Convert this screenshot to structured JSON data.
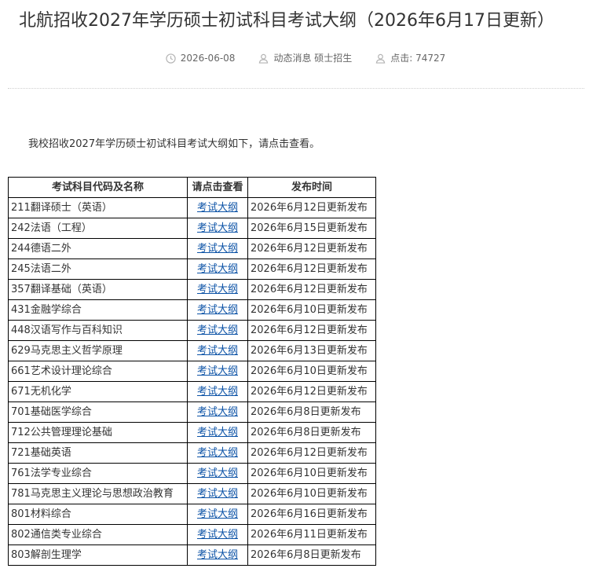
{
  "article": {
    "title": "北航招收2027年学历硕士初试科目考试大纲（2026年6月17日更新）",
    "meta": {
      "date": "2026-06-08",
      "category": "动态消息 硕士招生",
      "views_label": "点击: 74727"
    },
    "intro": "我校招收2027年学历硕士初试科目考试大纲如下，请点击查看。"
  },
  "table": {
    "headers": [
      "考试科目代码及名称",
      "请点击查看",
      "发布时间"
    ],
    "rows": [
      {
        "name": "211翻译硕士（英语）",
        "link": "考试大纲",
        "date": "2026年6月12日更新发布"
      },
      {
        "name": "242法语（工程）",
        "link": "考试大纲",
        "date": "2026年6月15日更新发布"
      },
      {
        "name": "244德语二外",
        "link": "考试大纲",
        "date": "2026年6月12日更新发布"
      },
      {
        "name": "245法语二外",
        "link": "考试大纲",
        "date": "2026年6月12日更新发布"
      },
      {
        "name": "357翻译基础（英语）",
        "link": "考试大纲",
        "date": "2026年6月12日更新发布"
      },
      {
        "name": "431金融学综合",
        "link": "考试大纲",
        "date": "2026年6月10日更新发布"
      },
      {
        "name": "448汉语写作与百科知识",
        "link": "考试大纲",
        "date": "2026年6月12日更新发布"
      },
      {
        "name": "629马克思主义哲学原理",
        "link": "考试大纲",
        "date": "2026年6月13日更新发布"
      },
      {
        "name": "661艺术设计理论综合",
        "link": "考试大纲",
        "date": "2026年6月10日更新发布"
      },
      {
        "name": "671无机化学",
        "link": "考试大纲",
        "date": "2026年6月12日更新发布"
      },
      {
        "name": "701基础医学综合",
        "link": "考试大纲",
        "date": "2026年6月8日更新发布"
      },
      {
        "name": "712公共管理理论基础",
        "link": "考试大纲",
        "date": "2026年6月8日更新发布"
      },
      {
        "name": "721基础英语",
        "link": "考试大纲",
        "date": "2026年6月12日更新发布"
      },
      {
        "name": "761法学专业综合",
        "link": "考试大纲",
        "date": "2026年6月10日更新发布"
      },
      {
        "name": "781马克思主义理论与思想政治教育",
        "link": "考试大纲",
        "date": "2026年6月10日更新发布"
      },
      {
        "name": "801材料综合",
        "link": "考试大纲",
        "date": "2026年6月16日更新发布"
      },
      {
        "name": "802通信类专业综合",
        "link": "考试大纲",
        "date": "2026年6月11日更新发布"
      },
      {
        "name": "803解剖生理学",
        "link": "考试大纲",
        "date": "2026年6月8日更新发布"
      }
    ]
  },
  "colors": {
    "text": "#333333",
    "meta": "#666666",
    "link": "#0b52a6",
    "border": "#000000"
  },
  "icons": {
    "date": "clock-icon",
    "category": "user-icon",
    "views": "user-icon"
  }
}
